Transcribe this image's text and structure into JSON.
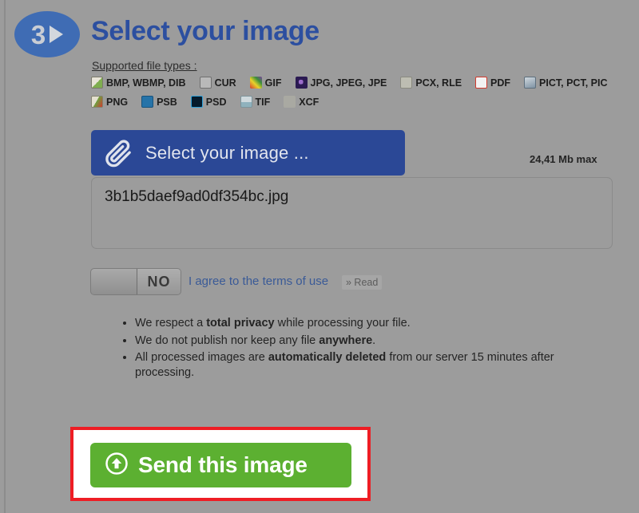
{
  "page": {
    "background_color": "#9c9c9c",
    "accent_blue": "#2c4fa0",
    "accent_green": "#5cb031",
    "highlight_red": "#ee1d24"
  },
  "header": {
    "step_number": "3",
    "step_arrow_icon": "play-triangle-icon",
    "title": "Select your image"
  },
  "supported": {
    "label": "Supported file types :",
    "rows": [
      [
        {
          "icon": "bmp-file-icon",
          "icon_class": "ico-bmp",
          "label": "BMP, WBMP, DIB"
        },
        {
          "icon": "cur-file-icon",
          "icon_class": "ico-cur",
          "label": "CUR"
        },
        {
          "icon": "gif-file-icon",
          "icon_class": "ico-gif",
          "label": "GIF"
        },
        {
          "icon": "jpg-file-icon",
          "icon_class": "ico-jpg",
          "label": "JPG, JPEG, JPE"
        },
        {
          "icon": "pcx-file-icon",
          "icon_class": "ico-pcx",
          "label": "PCX, RLE"
        },
        {
          "icon": "pdf-file-icon",
          "icon_class": "ico-pdf",
          "label": "PDF"
        },
        {
          "icon": "pict-file-icon",
          "icon_class": "ico-pict",
          "label": "PICT, PCT, PIC"
        }
      ],
      [
        {
          "icon": "png-file-icon",
          "icon_class": "ico-png",
          "label": "PNG"
        },
        {
          "icon": "psb-file-icon",
          "icon_class": "ico-psb",
          "label": "PSB"
        },
        {
          "icon": "psd-file-icon",
          "icon_class": "ico-psd",
          "label": "PSD"
        },
        {
          "icon": "tif-file-icon",
          "icon_class": "ico-tif",
          "label": "TIF"
        },
        {
          "icon": "xcf-file-icon",
          "icon_class": "ico-xcf",
          "label": "XCF"
        }
      ]
    ]
  },
  "selector": {
    "button_label": "Select your image ...",
    "button_icon": "paperclip-icon",
    "max_size_text": "24,41 Mb max",
    "selected_file_name": "3b1b5daef9ad0df354bc.jpg"
  },
  "terms": {
    "toggle_state_label": "NO",
    "agree_text": "I agree to the terms of use",
    "read_link_label": "» Read"
  },
  "privacy_notes": [
    {
      "prefix": "We respect a ",
      "bold": "total privacy",
      "suffix": " while processing your file."
    },
    {
      "prefix": "We do not publish nor keep any file ",
      "bold": "anywhere",
      "suffix": "."
    },
    {
      "prefix": "All processed images are ",
      "bold": "automatically deleted",
      "suffix": " from our server 15 minutes after processing."
    }
  ],
  "submit": {
    "label": "Send this image",
    "icon": "upload-arrow-circle-icon"
  }
}
